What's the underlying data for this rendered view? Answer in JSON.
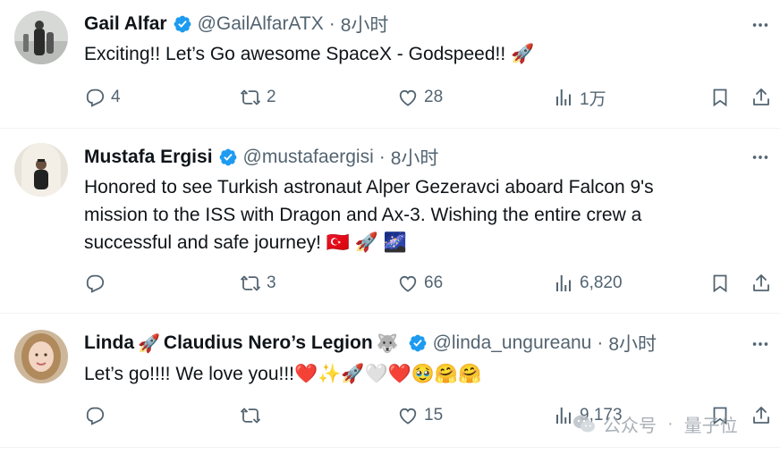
{
  "tweets": [
    {
      "name": "Gail Alfar",
      "name_suffix_emoji": "",
      "name_part2": "",
      "name_part3_emoji": "",
      "handle": "@GailAlfarATX",
      "time": "8小时",
      "text": "Exciting!! Let’s Go awesome SpaceX - Godspeed!! 🚀",
      "replies": "4",
      "reposts": "2",
      "likes": "28",
      "views": "1万"
    },
    {
      "name": "Mustafa Ergisi",
      "handle": "@mustafaergisi",
      "time": "8小时",
      "text_lines": [
        "Honored to see Turkish astronaut Alper Gezeravci aboard Falcon 9's",
        "mission to the ISS with Dragon and Ax-3. Wishing the entire crew a",
        "successful and safe journey! 🇹🇷 🚀 🌌"
      ],
      "replies": "",
      "reposts": "3",
      "likes": "66",
      "views": "6,820"
    },
    {
      "name_a": "Linda",
      "name_emoji_a": "🚀",
      "name_b": "Claudius Nero’s Legion",
      "name_emoji_b": "🐺",
      "handle": "@linda_ungureanu",
      "time": "8小时",
      "text": "Let’s go!!!! We love you!!!❤️✨🚀🤍❤️🥹🤗🤗",
      "replies": "",
      "reposts": "",
      "likes": "15",
      "views": "9,173"
    }
  ],
  "watermark": {
    "label": "公众号",
    "separator": "·",
    "brand": "量子位"
  },
  "colors": {
    "text": "#0f1419",
    "muted": "#536471",
    "verified": "#1d9bf0",
    "divider": "#eff3f4"
  },
  "icons": [
    "verified-badge-icon",
    "more-icon",
    "reply-icon",
    "repost-icon",
    "like-icon",
    "views-icon",
    "bookmark-icon",
    "share-icon"
  ]
}
